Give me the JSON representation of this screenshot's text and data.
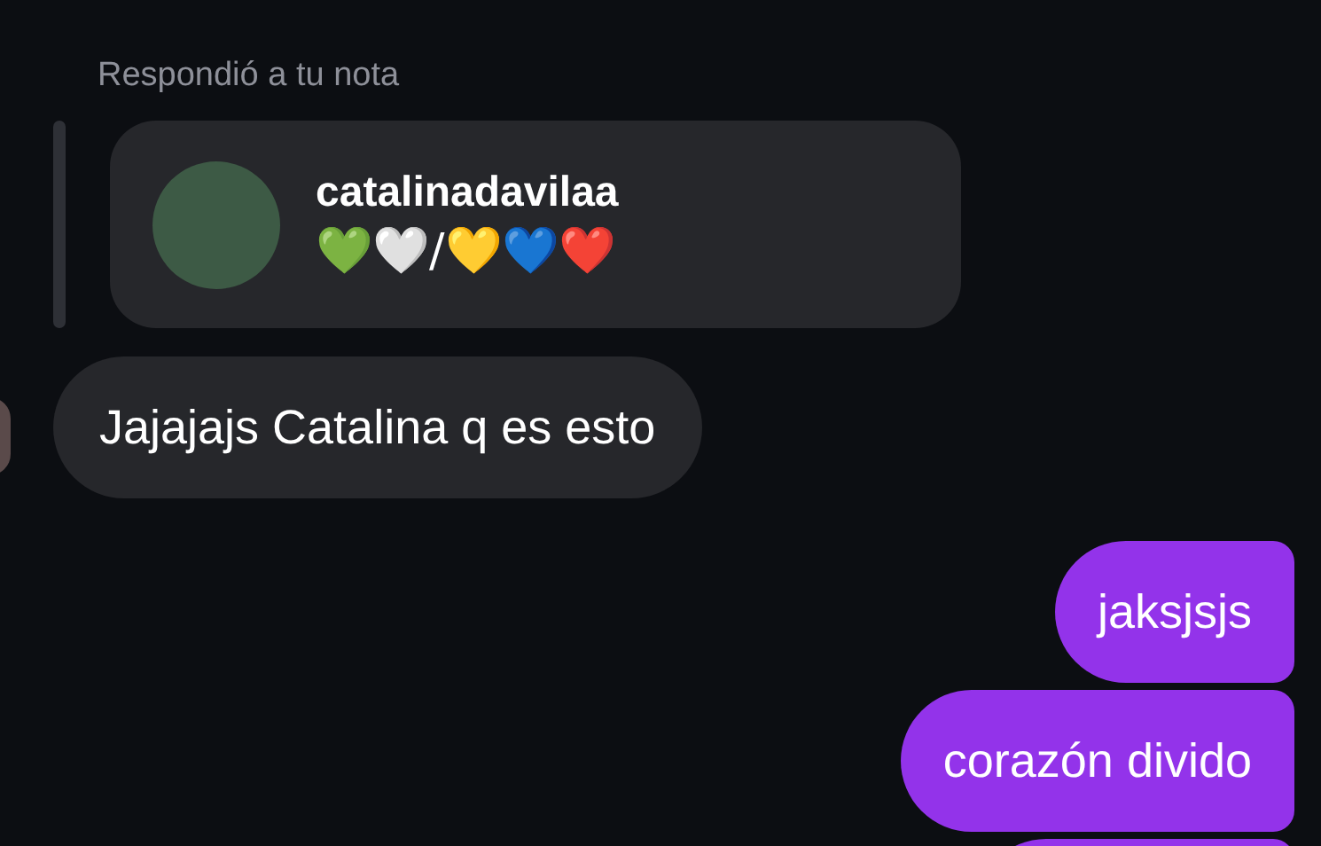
{
  "reply_label": "Respondió a tu nota",
  "note": {
    "username": "catalinadavilaa",
    "text": "💚🤍/💛💙❤️"
  },
  "messages": [
    {
      "kind": "incoming",
      "text": "Jajajajs Catalina q es esto"
    },
    {
      "kind": "outgoing",
      "text": "jaksjsjs"
    },
    {
      "kind": "outgoing",
      "text": "corazón divido"
    },
    {
      "kind": "outgoing_cut"
    }
  ]
}
